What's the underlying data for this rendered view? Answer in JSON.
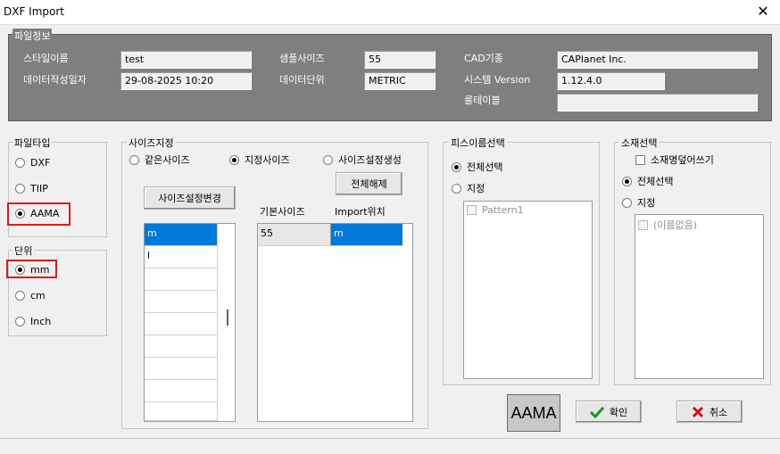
{
  "window": {
    "title": "DXF Import",
    "close_glyph": "✕"
  },
  "file_info": {
    "legend": "파일정보",
    "style_name_label": "스타일이름",
    "style_name_value": "test",
    "created_date_label": "데이터작성일자",
    "created_date_value": "29-08-2025 10:20",
    "sample_size_label": "샘플사이즈",
    "sample_size_value": "55",
    "data_unit_label": "데이터단위",
    "data_unit_value": "METRIC",
    "cad_system_label": "CAD기종",
    "cad_system_value": "CAPlanet Inc.",
    "system_version_label": "시스템 Version",
    "system_version_value": "1.12.4.0",
    "rule_table_label": "룰테이블",
    "rule_table_value": ""
  },
  "file_type": {
    "legend": "파일타입",
    "options": [
      "DXF",
      "TIIP",
      "AAMA"
    ],
    "selected": "AAMA"
  },
  "unit": {
    "legend": "단위",
    "options": [
      "mm",
      "cm",
      "Inch"
    ],
    "selected": "mm"
  },
  "size_spec": {
    "legend": "사이즈지정",
    "options": [
      "같은사이즈",
      "지정사이즈",
      "사이즈설정생성"
    ],
    "selected": "지정사이즈",
    "change_button": "사이즈설정변경",
    "clear_button": "전체해제",
    "base_size_header": "기본사이즈",
    "import_pos_header": "Import위치",
    "left_list": [
      "m",
      "l"
    ],
    "base_size_value": "55",
    "import_pos_value": "m"
  },
  "piece_select": {
    "legend": "피스이름선택",
    "options": [
      "전체선택",
      "지정"
    ],
    "selected": "전체선택",
    "items": [
      "Pattern1"
    ]
  },
  "material_select": {
    "legend": "소재선택",
    "overwrite_label": "소재명덮어쓰기",
    "options": [
      "전체선택",
      "지정"
    ],
    "selected": "전체선택",
    "items": [
      "(이름없음)"
    ]
  },
  "footer": {
    "preview_badge": "AAMA",
    "ok_button": "확인",
    "cancel_button": "취소"
  },
  "colors": {
    "selection": "#0078d7",
    "highlight_box": "#e01a1a",
    "info_panel_bg": "#7f7f7f"
  }
}
